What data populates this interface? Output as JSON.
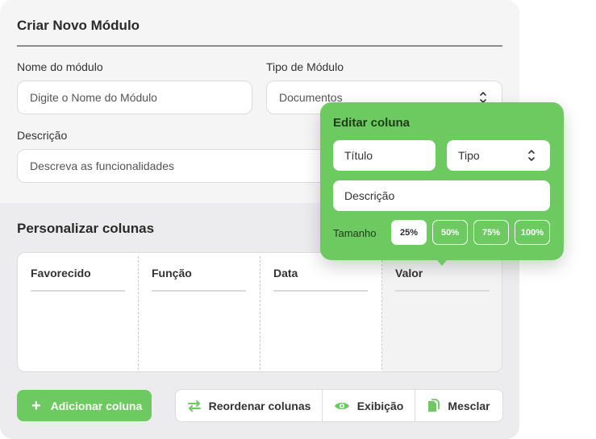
{
  "form": {
    "title": "Criar Novo Módulo",
    "module_name": {
      "label": "Nome do módulo",
      "placeholder": "Digite o Nome do Módulo"
    },
    "module_type": {
      "label": "Tipo de Módulo",
      "value": "Documentos"
    },
    "description": {
      "label": "Descrição",
      "placeholder": "Descreva as funcionalidades"
    }
  },
  "customize": {
    "title": "Personalizar colunas",
    "columns": [
      {
        "label": "Favorecido"
      },
      {
        "label": "Função"
      },
      {
        "label": "Data"
      },
      {
        "label": "Valor"
      }
    ]
  },
  "actions": {
    "add_column": "Adicionar coluna",
    "reorder": "Reordenar colunas",
    "display": "Exibição",
    "merge": "Mesclar"
  },
  "edit_popover": {
    "title": "Editar coluna",
    "title_field": "Título",
    "type_field": "Tipo",
    "description_field": "Descrição",
    "size_label": "Tamanho",
    "sizes": [
      "25%",
      "50%",
      "75%",
      "100%"
    ],
    "selected_size": "25%"
  },
  "colors": {
    "accent": "#6dca60",
    "panel": "#f5f5f6",
    "panel_alt": "#ececee"
  }
}
